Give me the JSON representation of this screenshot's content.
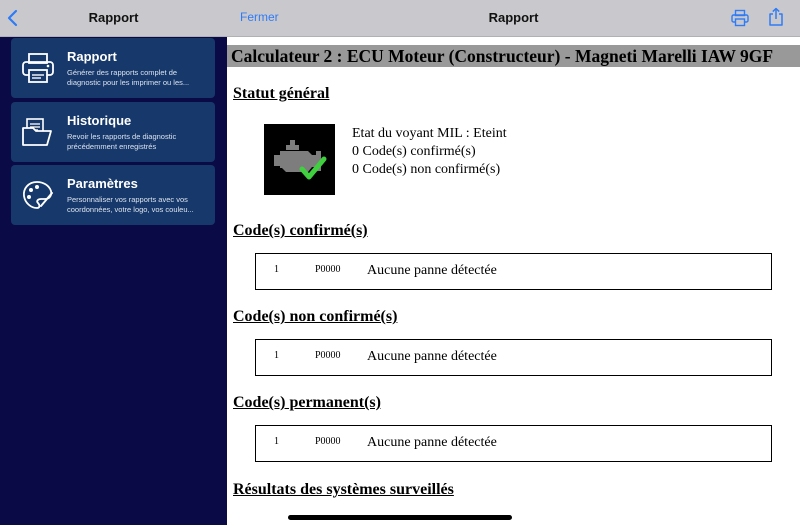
{
  "sidebar": {
    "title": "Rapport",
    "items": [
      {
        "title": "Rapport",
        "desc1": "Générer des rapports complet de",
        "desc2": "diagnostic pour les imprimer ou les...",
        "icon": "printer-icon"
      },
      {
        "title": "Historique",
        "desc1": "Revoir les rapports de diagnostic",
        "desc2": "précédemment enregistrés",
        "icon": "folder-documents-icon"
      },
      {
        "title": "Paramètres",
        "desc1": "Personnaliser vos rapports avec vos",
        "desc2": "coordonnées, votre logo, vos couleu...",
        "icon": "palette-icon"
      }
    ]
  },
  "header": {
    "close_label": "Fermer",
    "title": "Rapport"
  },
  "report": {
    "ecu_title": "Calculateur 2 : ECU Moteur (Constructeur) - Magneti Marelli IAW 9GF",
    "status_title": "Statut général",
    "status_lines": [
      "Etat du voyant MIL : Eteint",
      "0 Code(s) confirmé(s)",
      "0 Code(s) non confirmé(s)"
    ],
    "sections": [
      {
        "title": "Code(s) confirmé(s)",
        "num": "1",
        "code": "P0000",
        "text": "Aucune panne détectée"
      },
      {
        "title": "Code(s) non confirmé(s)",
        "num": "1",
        "code": "P0000",
        "text": "Aucune panne détectée"
      },
      {
        "title": "Code(s) permanent(s)",
        "num": "1",
        "code": "P0000",
        "text": "Aucune panne détectée"
      }
    ],
    "monitored_title": "Résultats des systèmes surveillés"
  },
  "colors": {
    "sidebar_bg": "#0a0a47",
    "card_bg": "#17386a",
    "header_bg": "#c9c9cd",
    "accent": "#2f7bf6",
    "banner_bg": "#999999",
    "check_green": "#3fcf3f"
  }
}
